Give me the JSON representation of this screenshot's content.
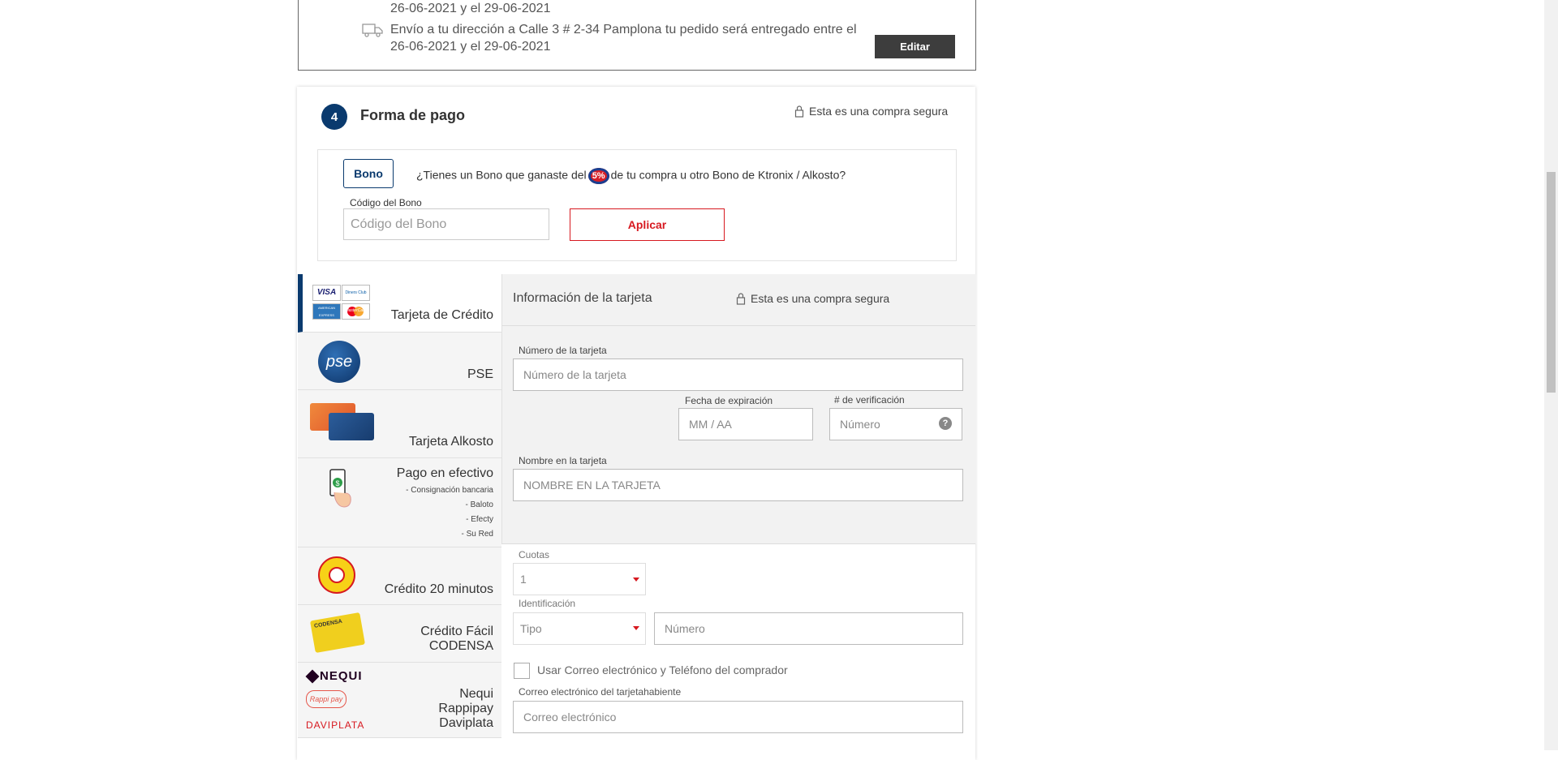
{
  "shipping": {
    "line1_tail": "26-06-2021 y el 29-06-2021",
    "line2_a": "Envío a tu dirección a Calle 3 # 2-34  Pamplona tu pedido será entregado entre el",
    "line2_b": "26-06-2021 y el 29-06-2021",
    "edit_label": "Editar"
  },
  "payment": {
    "step_number": "4",
    "title": "Forma de pago",
    "secure_label": "Esta es una compra segura"
  },
  "bono": {
    "button_label": "Bono",
    "question_a": "¿Tienes un Bono que ganaste del",
    "logo_text": "5%",
    "question_b": "de tu compra u otro Bono de Ktronix / Alkosto?",
    "code_label": "Código del Bono",
    "code_placeholder": "Código del Bono",
    "apply_label": "Aplicar"
  },
  "methods": [
    {
      "label": "Tarjeta de Crédito",
      "active": true
    },
    {
      "label": "PSE"
    },
    {
      "label": "Tarjeta Alkosto"
    },
    {
      "label": "Pago en efectivo",
      "sub": [
        "- Consignación bancaria",
        "- Baloto",
        "- Efecty",
        "- Su Red"
      ]
    },
    {
      "label": "Crédito 20 minutos"
    },
    {
      "label_lines": [
        "Crédito Fácil",
        "CODENSA"
      ]
    },
    {
      "label_lines": [
        "Nequi",
        "Rappipay",
        "Daviplata"
      ]
    }
  ],
  "logos": {
    "visa": "VISA",
    "diners": "Diners Club",
    "amex": "AMERICAN EXPRESS",
    "mastercard": "MasterCard",
    "pse": "pse",
    "nequi": "NEQUI",
    "rappipay": "Rappi pay",
    "daviplata": "DAVIPLATA",
    "codensa": "CODENSA"
  },
  "card_info": {
    "title": "Información de la tarjeta",
    "secure_label": "Esta es una compra segura",
    "number_label": "Número de la tarjeta",
    "number_placeholder": "Número de la tarjeta",
    "expiry_label": "Fecha de expiración",
    "expiry_placeholder": "MM / AA",
    "cvv_label": "# de verificación",
    "cvv_placeholder": "Número",
    "help_glyph": "?",
    "name_label": "Nombre en la tarjeta",
    "name_placeholder": "NOMBRE EN LA TARJETA",
    "cuotas_label": "Cuotas",
    "cuotas_value": "1",
    "id_label": "Identificación",
    "id_type_value": "Tipo",
    "id_number_placeholder": "Número",
    "use_buyer_label": "Usar Correo electrónico y Teléfono del comprador",
    "email_label": "Correo electrónico del tarjetahabiente",
    "email_placeholder": "Correo electrónico"
  },
  "colors": {
    "brand_blue": "#0a3a6e",
    "brand_red": "#d71920",
    "dark_button": "#3d3d3d"
  }
}
